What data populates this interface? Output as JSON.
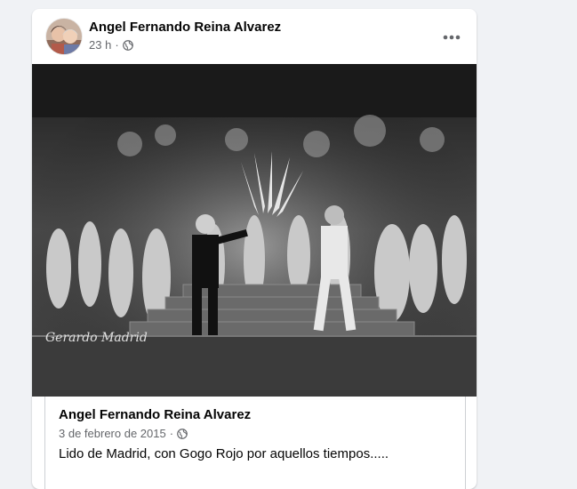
{
  "post": {
    "author": "Angel Fernando Reina Alvarez",
    "time": "23 h",
    "separator": "·",
    "audience_icon": "globe-icon",
    "more_icon": "more-options-icon"
  },
  "shared_post": {
    "author": "Angel Fernando Reina Alvarez",
    "date": "3 de febrero de 2015",
    "separator": "·",
    "audience_icon": "globe-icon",
    "text": "Lido de Madrid, con Gogo Rojo por aquellos tiempos....."
  },
  "photo": {
    "signature": "Gerardo Madrid"
  },
  "colors": {
    "background": "#f0f2f5",
    "card": "#ffffff",
    "primary_text": "#050505",
    "secondary_text": "#65676b",
    "border": "#ced0d4"
  }
}
